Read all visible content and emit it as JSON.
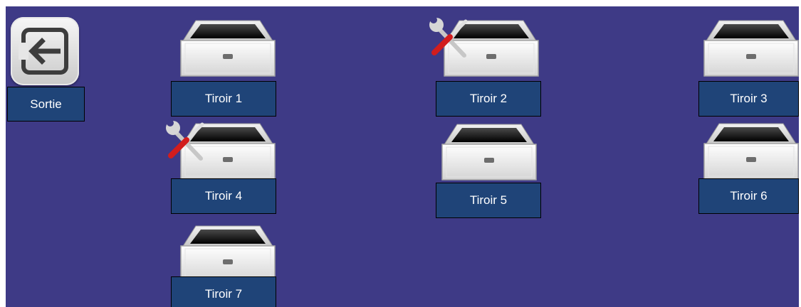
{
  "exit": {
    "label": "Sortie",
    "icon": "exit-arrow-icon"
  },
  "drawers": [
    {
      "label": "Tiroir 1",
      "maintenance": false
    },
    {
      "label": "Tiroir 2",
      "maintenance": true
    },
    {
      "label": "Tiroir 3",
      "maintenance": false
    },
    {
      "label": "Tiroir 4",
      "maintenance": true
    },
    {
      "label": "Tiroir 5",
      "maintenance": false
    },
    {
      "label": "Tiroir 6",
      "maintenance": false
    },
    {
      "label": "Tiroir 7",
      "maintenance": false
    }
  ],
  "colors": {
    "background": "#3e3a86",
    "label_background": "#1f4478",
    "label_text": "#ffffff"
  }
}
